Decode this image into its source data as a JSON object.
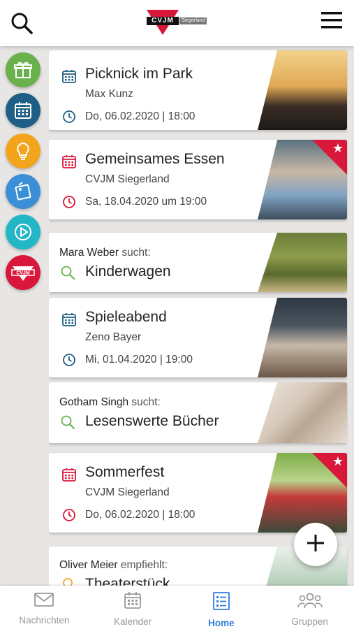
{
  "header": {
    "logo_text": "CVJM",
    "logo_sub": "Siegerland"
  },
  "rail": {
    "items": [
      {
        "icon": "gift-icon",
        "color": "#6ab04c"
      },
      {
        "icon": "calendar-icon",
        "color": "#1f5f85"
      },
      {
        "icon": "lightbulb-icon",
        "color": "#f2a51c"
      },
      {
        "icon": "tag-icon",
        "color": "#3a8fd6"
      },
      {
        "icon": "play-icon",
        "color": "#22b6c7"
      },
      {
        "icon": "cvjm-logo-icon",
        "color": "#d8173a"
      }
    ]
  },
  "feed": {
    "cards": [
      {
        "type": "event",
        "title": "Picknick im Park",
        "host": "Max Kunz",
        "date": "Do, 06.02.2020 | 18:00",
        "accent": "#1f5f85",
        "featured": false
      },
      {
        "type": "event",
        "title": "Gemeinsames Essen",
        "host": "CVJM Siegerland",
        "date": "Sa, 18.04.2020 um 19:00",
        "accent": "#d8173a",
        "featured": true
      },
      {
        "type": "search",
        "person": "Mara Weber",
        "verb": "sucht:",
        "title": "Kinderwagen"
      },
      {
        "type": "event",
        "title": "Spieleabend",
        "host": "Zeno Bayer",
        "date": "Mi, 01.04.2020 | 19:00",
        "accent": "#1f5f85",
        "featured": false
      },
      {
        "type": "search",
        "person": "Gotham Singh",
        "verb": "sucht:",
        "title": "Lesenswerte Bücher"
      },
      {
        "type": "event",
        "title": "Sommerfest",
        "host": "CVJM Siegerland",
        "date": "Do, 06.02.2020 | 18:00",
        "accent": "#d8173a",
        "featured": true
      },
      {
        "type": "recommend",
        "person": "Oliver Meier",
        "verb": "empfiehlt:",
        "title": "Theaterstück"
      }
    ]
  },
  "tabs": [
    {
      "label": "Nachrichten",
      "icon": "mail-icon",
      "active": false
    },
    {
      "label": "Kalender",
      "icon": "calendar-icon",
      "active": false
    },
    {
      "label": "Home",
      "icon": "list-icon",
      "active": true
    },
    {
      "label": "Gruppen",
      "icon": "group-icon",
      "active": false
    }
  ]
}
